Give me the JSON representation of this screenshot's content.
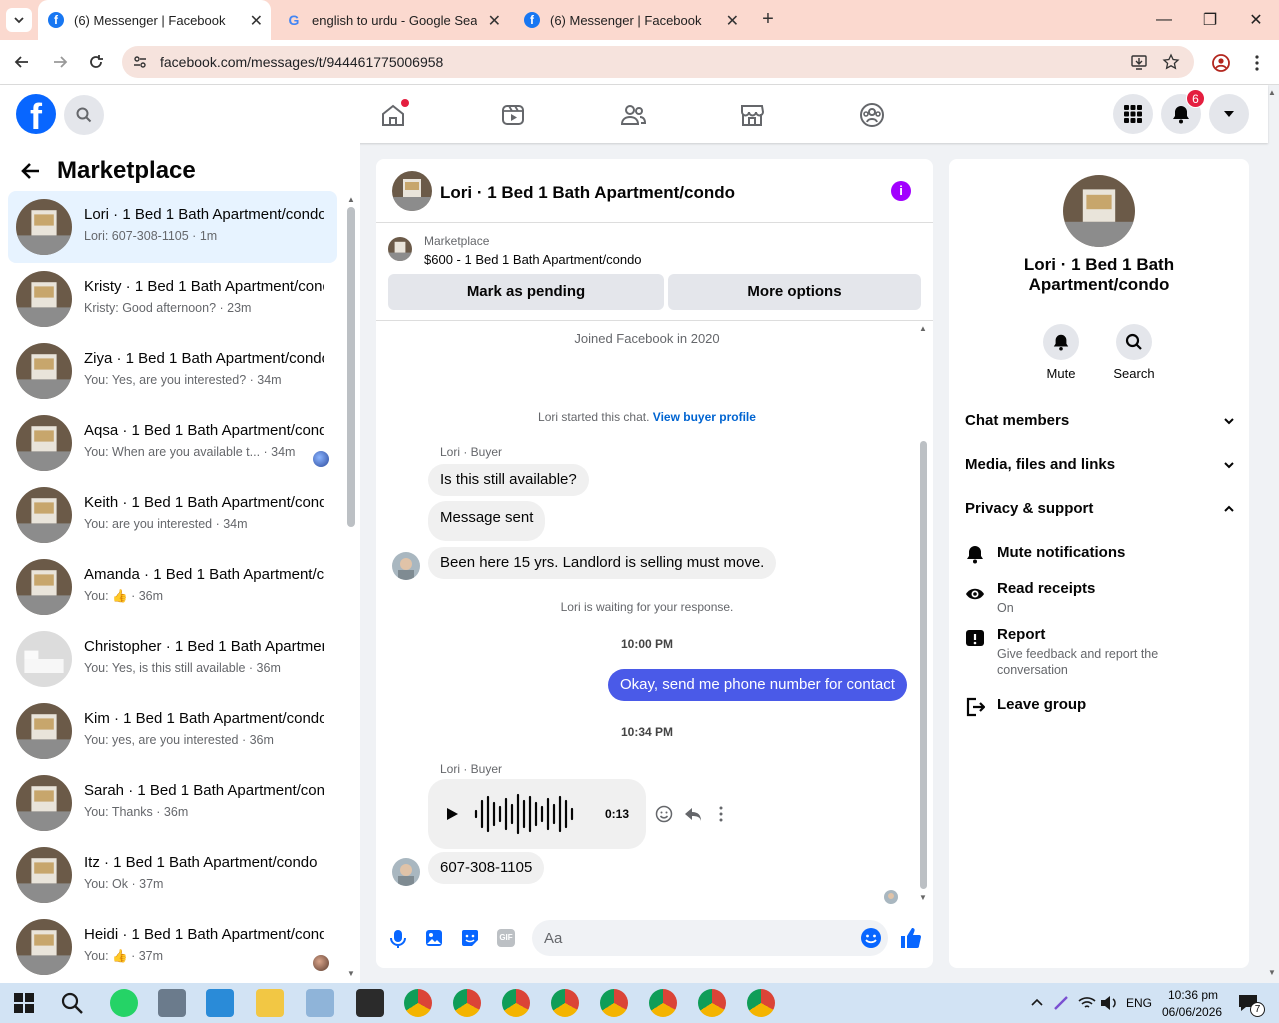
{
  "browser": {
    "tabs": [
      {
        "title": "(6) Messenger | Facebook",
        "icon": "facebook-favicon"
      },
      {
        "title": "english to urdu - Google Search",
        "icon": "google-favicon"
      },
      {
        "title": "(6) Messenger | Facebook",
        "icon": "facebook-favicon"
      }
    ],
    "url": "facebook.com/messages/t/944461775006958"
  },
  "header": {
    "notification_count": "6"
  },
  "left": {
    "title": "Marketplace",
    "conversations": [
      {
        "name": "Lori · 1 Bed 1 Bath Apartment/condo",
        "preview": "Lori: 607-308-1105 · 1m"
      },
      {
        "name": "Kristy · 1 Bed 1 Bath Apartment/condo",
        "preview": "Kristy: Good afternoon? · 23m"
      },
      {
        "name": "Ziya · 1 Bed 1 Bath Apartment/condo",
        "preview": "You: Yes, are you interested? · 34m"
      },
      {
        "name": "Aqsa · 1 Bed 1 Bath Apartment/condo",
        "preview": "You: When are you available t... · 34m"
      },
      {
        "name": "Keith · 1 Bed 1 Bath Apartment/condo",
        "preview": "You: are you interested · 34m"
      },
      {
        "name": "Amanda · 1 Bed 1 Bath Apartment/condo",
        "preview": "You: 👍 · 36m"
      },
      {
        "name": "Christopher · 1 Bed 1 Bath Apartment/condo",
        "preview": "You: Yes, is this still available · 36m"
      },
      {
        "name": "Kim · 1 Bed 1 Bath Apartment/condo",
        "preview": "You: yes, are you interested · 36m"
      },
      {
        "name": "Sarah · 1 Bed 1 Bath Apartment/condo",
        "preview": "You: Thanks · 36m"
      },
      {
        "name": "Itz · 1 Bed 1 Bath Apartment/condo",
        "preview": "You: Ok · 37m"
      },
      {
        "name": "Heidi · 1 Bed 1 Bath Apartment/condo",
        "preview": "You: 👍 · 37m"
      }
    ]
  },
  "chat": {
    "title": "Lori · 1 Bed 1 Bath Apartment/condo",
    "listing_label": "Marketplace",
    "listing_title": "$600 - 1 Bed 1 Bath Apartment/condo",
    "btn_pending": "Mark as pending",
    "btn_more": "More options",
    "joined": "Joined Facebook in 2020",
    "started": "Lori started this chat.",
    "view_profile": "View buyer profile",
    "sender1": "Lori · Buyer",
    "msg1": "Is this still available?",
    "msg2": "Message sent",
    "msg3": "Been here 15 yrs. Landlord is selling must move.",
    "waiting": "Lori is waiting for your response.",
    "time1": "10:00 PM",
    "msg_out": "Okay, send me phone number for contact",
    "time2": "10:34 PM",
    "sender2": "Lori · Buyer",
    "audio_duration": "0:13",
    "msg4": "607-308-1105",
    "input_placeholder": "Aa",
    "accent": "#0866ff",
    "outgoing_color": "#4a5ae8"
  },
  "right": {
    "name": "Lori · 1 Bed 1 Bath Apartment/condo",
    "mute": "Mute",
    "search": "Search",
    "chat_members": "Chat members",
    "media": "Media, files and links",
    "privacy": "Privacy & support",
    "mute_notifications": "Mute notifications",
    "read_receipts": "Read receipts",
    "read_receipts_state": "On",
    "report": "Report",
    "report_desc": "Give feedback and report the conversation",
    "leave_group": "Leave group"
  },
  "taskbar": {
    "lang": "ENG",
    "time": "10:36 pm",
    "date": "06/06/2026",
    "notif_count": "7"
  }
}
